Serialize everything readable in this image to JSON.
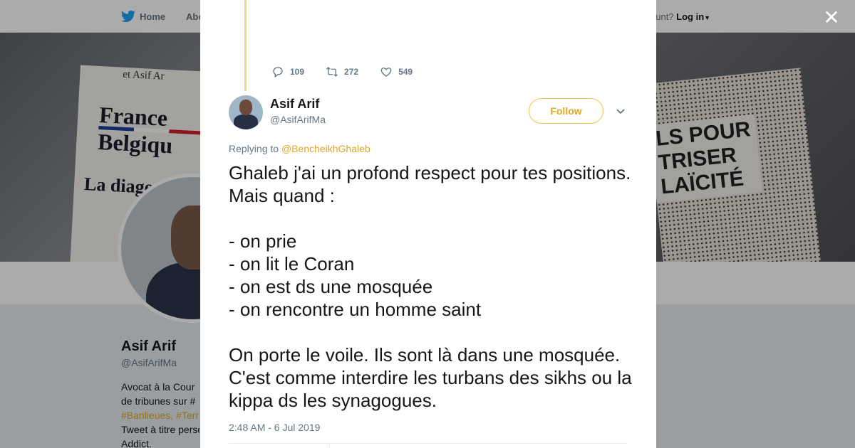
{
  "background": {
    "nav": {
      "home_label": "Home",
      "about_label": "Abo",
      "account_prompt": "ccount?",
      "login_label": "Log in"
    },
    "banner": {
      "book_left_lines": [
        "France",
        "Belgiqu",
        "La diagona",
        "et Asif Ar"
      ],
      "book_right_text": "LS POUR\nTRISER\nLAÏCITÉ"
    },
    "profile": {
      "name": "Asif Arif",
      "handle": "@AsifArifMa",
      "bio_lines": [
        "Avocat à la Cour",
        "de tribunes sur #",
        "#Banlieues, #Terr",
        "Tweet à titre perso",
        "Addict."
      ]
    }
  },
  "modal": {
    "close_icon": "close-icon",
    "previous_tweet_actions": {
      "replies": "109",
      "retweets": "272",
      "likes": "549"
    },
    "tweet": {
      "author_name": "Asif Arif",
      "author_handle": "@AsifArifMa",
      "follow_label": "Follow",
      "replying_to_prefix": "Replying to",
      "replying_to_handle": "@BencheikhGhaleb",
      "text": "Ghaleb j'ai un profond respect pour tes positions. Mais quand :\n\n- on prie\n- on lit le Coran\n- on est ds une mosquée\n- on rencontre un homme saint\n\nOn porte le voile. Ils sont là dans une mosquée. C'est comme interdire les turbans des sikhs ou la kippa ds les synagogues.",
      "timestamp": "2:48 AM - 6 Jul 2019"
    }
  },
  "colors": {
    "accent": "#e0a823",
    "thread_line": "#f5d58a",
    "text": "#14171a",
    "muted": "#657786"
  }
}
